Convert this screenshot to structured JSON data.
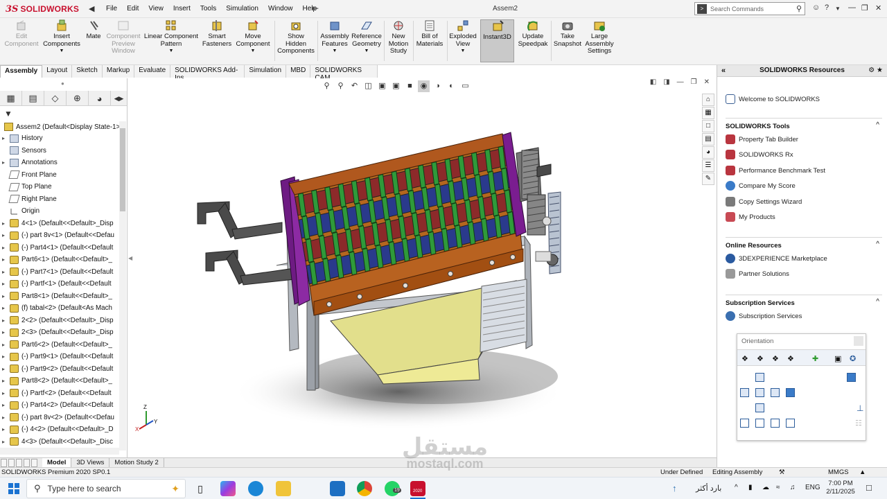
{
  "app": {
    "logo_text": "SOLIDWORKS",
    "document_title": "Assem2"
  },
  "menu": {
    "items": [
      "File",
      "Edit",
      "View",
      "Insert",
      "Tools",
      "Simulation",
      "Window",
      "Help"
    ]
  },
  "search": {
    "placeholder": "Search Commands"
  },
  "titlebar_right": {
    "user_icon": "user-icon",
    "help_icon": "help-icon"
  },
  "command_manager": {
    "buttons": [
      {
        "label": "Edit Component",
        "disabled": true,
        "icon": "edit-component-icon"
      },
      {
        "label": "Insert Components",
        "disabled": false,
        "icon": "insert-components-icon"
      },
      {
        "label": "Mate",
        "disabled": false,
        "icon": "mate-icon"
      },
      {
        "label": "Component Preview Window",
        "disabled": true,
        "icon": "preview-window-icon"
      },
      {
        "label": "Linear Component Pattern",
        "disabled": false,
        "icon": "linear-pattern-icon"
      },
      {
        "label": "Smart Fasteners",
        "disabled": false,
        "icon": "smart-fasteners-icon"
      },
      {
        "label": "Move Component",
        "disabled": false,
        "icon": "move-component-icon"
      },
      {
        "label": "Show Hidden Components",
        "disabled": false,
        "icon": "show-hidden-icon"
      },
      {
        "label": "Assembly Features",
        "disabled": false,
        "icon": "assembly-features-icon"
      },
      {
        "label": "Reference Geometry",
        "disabled": false,
        "icon": "reference-geometry-icon"
      },
      {
        "label": "New Motion Study",
        "disabled": false,
        "icon": "motion-study-icon"
      },
      {
        "label": "Bill of Materials",
        "disabled": false,
        "icon": "bom-icon"
      },
      {
        "label": "Exploded View",
        "disabled": false,
        "icon": "exploded-view-icon"
      },
      {
        "label": "Instant3D",
        "disabled": false,
        "active": true,
        "icon": "instant3d-icon"
      },
      {
        "label": "Update Speedpak",
        "disabled": false,
        "icon": "speedpak-icon"
      },
      {
        "label": "Take Snapshot",
        "disabled": false,
        "icon": "snapshot-icon"
      },
      {
        "label": "Large Assembly Settings",
        "disabled": false,
        "icon": "large-assembly-icon"
      }
    ]
  },
  "tabs": [
    "Assembly",
    "Layout",
    "Sketch",
    "Markup",
    "Evaluate",
    "SOLIDWORKS Add-Ins",
    "Simulation",
    "MBD",
    "SOLIDWORKS CAM"
  ],
  "feature_tree": {
    "root": "Assem2  (Default<Display State-1>",
    "items": [
      {
        "label": "History",
        "type": "folder",
        "expand": true
      },
      {
        "label": "Sensors",
        "type": "folder",
        "expand": false
      },
      {
        "label": "Annotations",
        "type": "folder",
        "expand": true
      },
      {
        "label": "Front Plane",
        "type": "plane",
        "expand": false
      },
      {
        "label": "Top Plane",
        "type": "plane",
        "expand": false
      },
      {
        "label": "Right Plane",
        "type": "plane",
        "expand": false
      },
      {
        "label": "Origin",
        "type": "origin",
        "expand": false
      },
      {
        "label": "4<1> (Default<<Default>_Disp",
        "type": "part",
        "expand": true
      },
      {
        "label": "(-) part 8v<1> (Default<<Defau",
        "type": "part",
        "expand": true
      },
      {
        "label": "(-) Part4<1> (Default<<Default",
        "type": "part",
        "expand": true
      },
      {
        "label": "Part6<1> (Default<<Default>_",
        "type": "part",
        "expand": true
      },
      {
        "label": "(-) Part7<1> (Default<<Default",
        "type": "part",
        "expand": true
      },
      {
        "label": "(-) Partf<1> (Default<<Default",
        "type": "part",
        "expand": true
      },
      {
        "label": "Part8<1> (Default<<Default>_",
        "type": "part",
        "expand": true
      },
      {
        "label": "(f) tabal<2> (Default<As Mach",
        "type": "part",
        "expand": true
      },
      {
        "label": "2<2> (Default<<Default>_Disp",
        "type": "part",
        "expand": true
      },
      {
        "label": "2<3> (Default<<Default>_Disp",
        "type": "part",
        "expand": true
      },
      {
        "label": "Part6<2> (Default<<Default>_",
        "type": "part",
        "expand": true
      },
      {
        "label": "(-) Part9<1> (Default<<Default",
        "type": "part",
        "expand": true
      },
      {
        "label": "(-) Part9<2> (Default<<Default",
        "type": "part",
        "expand": true
      },
      {
        "label": "Part8<2> (Default<<Default>_",
        "type": "part",
        "expand": true
      },
      {
        "label": "(-) Partf<2> (Default<<Default",
        "type": "part",
        "expand": true
      },
      {
        "label": "(-) Part4<2> (Default<<Default",
        "type": "part",
        "expand": true
      },
      {
        "label": "(-) part 8v<2> (Default<<Defau",
        "type": "part",
        "expand": true
      },
      {
        "label": "(-) 4<2> (Default<<Default>_D",
        "type": "part",
        "expand": true
      },
      {
        "label": "4<3> (Default<<Default>_Disc",
        "type": "part",
        "expand": true
      }
    ]
  },
  "model_tabs": [
    "Model",
    "3D Views",
    "Motion Study 2"
  ],
  "status_bar": {
    "product": "SOLIDWORKS Premium 2020 SP0.1",
    "state": "Under Defined",
    "mode": "Editing Assembly",
    "units": "MMGS"
  },
  "task_pane": {
    "title": "SOLIDWORKS Resources",
    "welcome": "Welcome to SOLIDWORKS",
    "sections": [
      {
        "title": "SOLIDWORKS Tools",
        "items": [
          "Property Tab Builder",
          "SOLIDWORKS Rx",
          "Performance Benchmark Test",
          "Compare My Score",
          "Copy Settings Wizard",
          "My Products"
        ]
      },
      {
        "title": "Online Resources",
        "items": [
          "3DEXPERIENCE Marketplace",
          "Partner Solutions"
        ]
      },
      {
        "title": "Subscription Services",
        "items": [
          "Subscription Services"
        ]
      }
    ]
  },
  "orientation": {
    "title": "Orientation"
  },
  "triad": {
    "x": "X",
    "y": "Y",
    "z": "Z"
  },
  "taskbar": {
    "search_placeholder": "Type here to search",
    "ime_text": "بارد أكثر",
    "lang": "ENG",
    "time": "7:00 PM",
    "date": "2/11/2025",
    "whatsapp_badge": "19",
    "sw_badge": "2020"
  },
  "watermark": {
    "arabic": "مستقل",
    "latin": "mostaql.com"
  }
}
